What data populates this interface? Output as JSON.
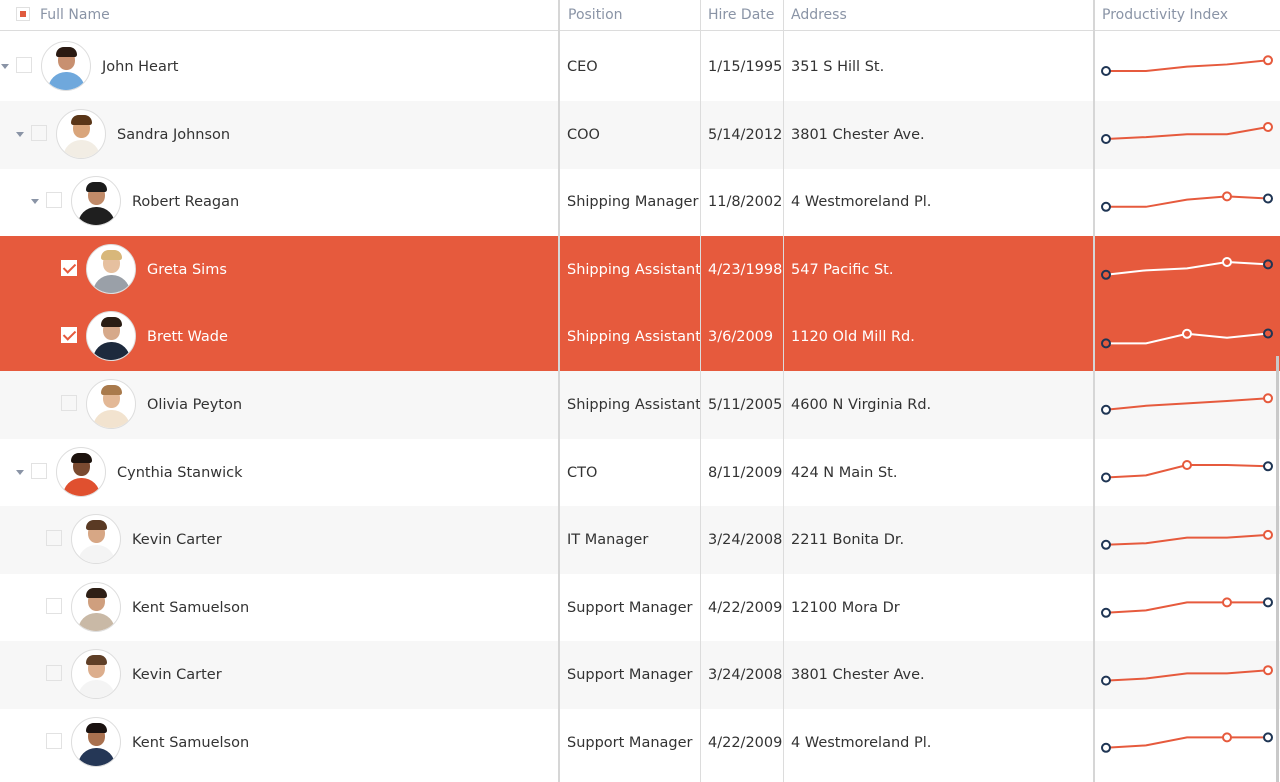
{
  "columns": {
    "full_name": "Full Name",
    "position": "Position",
    "hire_date": "Hire Date",
    "address": "Address",
    "productivity": "Productivity Index"
  },
  "colors": {
    "accent": "#e65a3d",
    "spark_line": "#e65a3d",
    "spark_dark": "#1f3554",
    "header_text": "#8a94a6"
  },
  "rows": [
    {
      "name": "John Heart",
      "position": "CEO",
      "hire_date": "1/15/1995",
      "address": "351 S Hill St.",
      "level": 0,
      "expandable": true,
      "checked": false,
      "selected": false,
      "avatar": {
        "skin": "#c89070",
        "hair": "#2a1a12",
        "body": "#6fa8dc"
      },
      "spark": [
        0.25,
        0.25,
        0.52,
        0.66,
        0.92
      ],
      "dark_points": [
        0
      ],
      "open_points": [
        4
      ]
    },
    {
      "name": "Sandra Johnson",
      "position": "COO",
      "hire_date": "5/14/2012",
      "address": "3801 Chester Ave.",
      "level": 1,
      "expandable": true,
      "checked": false,
      "selected": false,
      "avatar": {
        "skin": "#d9a57b",
        "hair": "#5a3618",
        "body": "#f2ede4"
      },
      "spark": [
        0.25,
        0.37,
        0.55,
        0.55,
        1.0
      ],
      "dark_points": [
        0
      ],
      "open_points": [
        4
      ]
    },
    {
      "name": "Robert Reagan",
      "position": "Shipping Manager",
      "hire_date": "11/8/2002",
      "address": "4 Westmoreland Pl.",
      "level": 2,
      "expandable": true,
      "checked": false,
      "selected": false,
      "avatar": {
        "skin": "#c08a68",
        "hair": "#1b1b1b",
        "body": "#1f1f1f"
      },
      "spark": [
        0.2,
        0.2,
        0.65,
        0.85,
        0.72
      ],
      "dark_points": [
        0,
        4
      ],
      "open_points": [
        3
      ]
    },
    {
      "name": "Greta Sims",
      "position": "Shipping Assistant",
      "hire_date": "4/23/1998",
      "address": "547 Pacific St.",
      "level": 3,
      "expandable": false,
      "checked": true,
      "selected": true,
      "avatar": {
        "skin": "#e6c09f",
        "hair": "#d8b77a",
        "body": "#9aa0a8"
      },
      "spark": [
        0.2,
        0.48,
        0.6,
        1.0,
        0.85
      ],
      "dark_points": [
        0,
        4
      ],
      "open_points": [
        3
      ]
    },
    {
      "name": "Brett Wade",
      "position": "Shipping Assistant",
      "hire_date": "3/6/2009",
      "address": "1120 Old Mill Rd.",
      "level": 3,
      "expandable": false,
      "checked": true,
      "selected": true,
      "avatar": {
        "skin": "#d6a98a",
        "hair": "#2a1d14",
        "body": "#1d2a3d"
      },
      "spark": [
        0.1,
        0.1,
        0.7,
        0.45,
        0.72
      ],
      "dark_points": [
        0,
        4
      ],
      "open_points": [
        2
      ]
    },
    {
      "name": "Olivia Peyton",
      "position": "Shipping Assistant",
      "hire_date": "5/11/2005",
      "address": "4600 N Virginia Rd.",
      "level": 3,
      "expandable": false,
      "checked": false,
      "selected": false,
      "avatar": {
        "skin": "#e3b896",
        "hair": "#a97a4c",
        "body": "#f2e3cf"
      },
      "spark": [
        0.2,
        0.45,
        0.6,
        0.75,
        0.92
      ],
      "dark_points": [
        0
      ],
      "open_points": [
        4
      ]
    },
    {
      "name": "Cynthia Stanwick",
      "position": "CTO",
      "hire_date": "8/11/2009",
      "address": "424 N Main St.",
      "level": 1,
      "expandable": true,
      "checked": false,
      "selected": false,
      "avatar": {
        "skin": "#7a4a30",
        "hair": "#1c120d",
        "body": "#e0502f"
      },
      "spark": [
        0.22,
        0.35,
        1.0,
        1.0,
        0.92
      ],
      "dark_points": [
        0,
        4
      ],
      "open_points": [
        2
      ]
    },
    {
      "name": "Kevin Carter",
      "position": "IT Manager",
      "hire_date": "3/24/2008",
      "address": "2211 Bonita Dr.",
      "level": 2,
      "expandable": false,
      "checked": false,
      "selected": false,
      "avatar": {
        "skin": "#d7a785",
        "hair": "#5a3a24",
        "body": "#f4f4f4"
      },
      "spark": [
        0.2,
        0.3,
        0.65,
        0.65,
        0.82
      ],
      "dark_points": [
        0
      ],
      "open_points": [
        4
      ]
    },
    {
      "name": "Kent Samuelson",
      "position": "Support Manager",
      "hire_date": "4/22/2009",
      "address": "12100 Mora Dr",
      "level": 2,
      "expandable": false,
      "checked": false,
      "selected": false,
      "avatar": {
        "skin": "#cf9f7e",
        "hair": "#2e1f16",
        "body": "#c9b9a6"
      },
      "spark": [
        0.2,
        0.35,
        0.85,
        0.85,
        0.85
      ],
      "dark_points": [
        0,
        4
      ],
      "open_points": [
        3
      ]
    },
    {
      "name": "Kevin Carter",
      "position": "Support Manager",
      "hire_date": "3/24/2008",
      "address": "3801 Chester Ave.",
      "level": 2,
      "expandable": false,
      "checked": false,
      "selected": false,
      "avatar": {
        "skin": "#dcae8d",
        "hair": "#5f3f27",
        "body": "#f4f4f4"
      },
      "spark": [
        0.15,
        0.28,
        0.6,
        0.6,
        0.8
      ],
      "dark_points": [
        0
      ],
      "open_points": [
        4
      ]
    },
    {
      "name": "Kent Samuelson",
      "position": "Support Manager",
      "hire_date": "4/22/2009",
      "address": "4 Westmoreland Pl.",
      "level": 2,
      "expandable": false,
      "checked": false,
      "selected": false,
      "avatar": {
        "skin": "#a9714f",
        "hair": "#1a1210",
        "body": "#253756"
      },
      "spark": [
        0.2,
        0.35,
        0.85,
        0.85,
        0.85
      ],
      "dark_points": [
        0,
        4
      ],
      "open_points": [
        3
      ]
    }
  ]
}
